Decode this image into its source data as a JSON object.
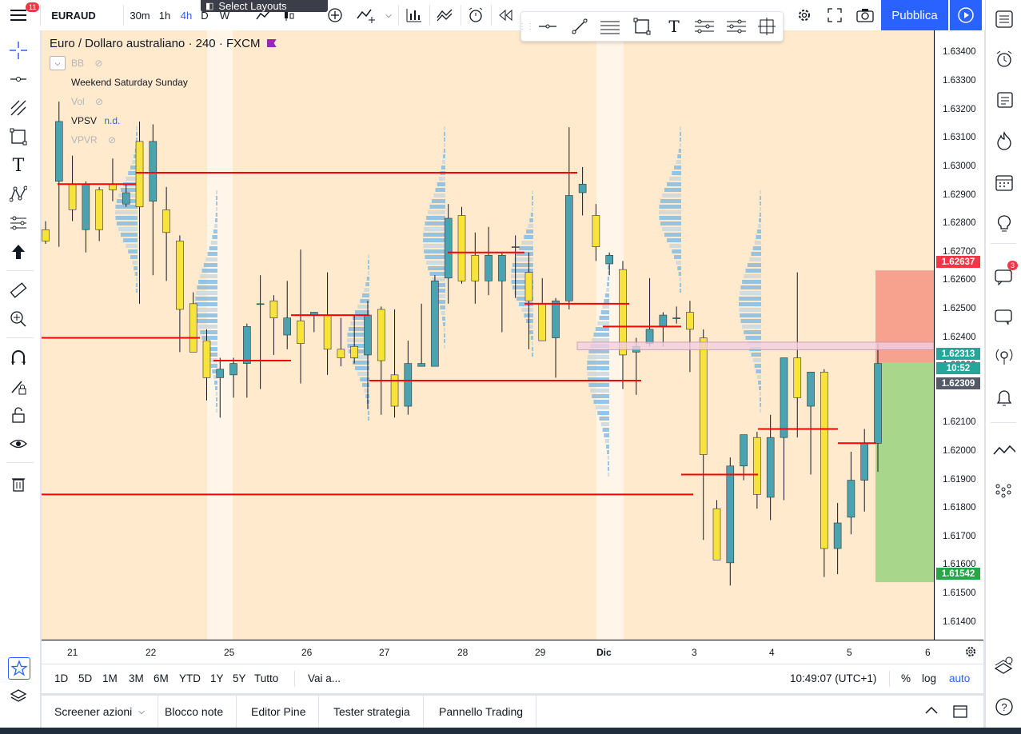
{
  "toolbar": {
    "menu_badge": "11",
    "symbol": "EURAUD",
    "intervals": [
      "30m",
      "1h",
      "4h",
      "D",
      "W"
    ],
    "active_interval": "4h",
    "publish_label": "Pubblica"
  },
  "select_layouts_label": "Select Layouts",
  "legend": {
    "title": "Euro / Dollaro australiano",
    "interval": "240",
    "exchange": "FXCM",
    "indicators": [
      {
        "name": "BB",
        "hidden": true
      },
      {
        "name": "Weekend Saturday Sunday",
        "hidden": false
      },
      {
        "name": "Vol",
        "hidden": true
      },
      {
        "name": "VPSV",
        "value": "n.d.",
        "hidden": false
      },
      {
        "name": "VPVR",
        "hidden": true
      }
    ]
  },
  "price_axis": {
    "labels": [
      "1.63400",
      "1.63300",
      "1.63200",
      "1.63100",
      "1.63000",
      "1.62900",
      "1.62800",
      "1.62700",
      "1.62600",
      "1.62500",
      "1.62400",
      "1.62300",
      "1.62100",
      "1.62000",
      "1.61900",
      "1.61800",
      "1.61700",
      "1.61600",
      "1.61500",
      "1.61400"
    ],
    "tags": [
      {
        "value": "1.62637",
        "color": "#f23645"
      },
      {
        "value": "1.62313",
        "color": "#26a69a"
      },
      {
        "value": "10:52",
        "color": "#26a69a"
      },
      {
        "value": "1.62309",
        "color": "#555b66"
      },
      {
        "value": "1.61542",
        "color": "#26a645"
      }
    ]
  },
  "time_axis": {
    "labels": [
      "21",
      "22",
      "25",
      "26",
      "27",
      "28",
      "29",
      "Dic",
      "3",
      "4",
      "5",
      "6"
    ]
  },
  "chart_data": {
    "type": "candlestick",
    "title": "Euro / Dollaro australiano",
    "ylim": [
      1.6134,
      1.6348
    ],
    "notes": "Candle values estimated from axis",
    "candles": [
      {
        "o": 1.6278,
        "h": 1.6281,
        "l": 1.6273,
        "c": 1.6274
      },
      {
        "o": 1.6295,
        "h": 1.6323,
        "l": 1.6272,
        "c": 1.6316
      },
      {
        "o": 1.6294,
        "h": 1.6304,
        "l": 1.6281,
        "c": 1.6285
      },
      {
        "o": 1.6278,
        "h": 1.6295,
        "l": 1.627,
        "c": 1.6294
      },
      {
        "o": 1.6292,
        "h": 1.6293,
        "l": 1.6274,
        "c": 1.6278
      },
      {
        "o": 1.6294,
        "h": 1.6303,
        "l": 1.6288,
        "c": 1.6292
      },
      {
        "o": 1.6287,
        "h": 1.6294,
        "l": 1.6286,
        "c": 1.6291
      },
      {
        "o": 1.6309,
        "h": 1.6316,
        "l": 1.6252,
        "c": 1.6286
      },
      {
        "o": 1.6288,
        "h": 1.6315,
        "l": 1.6262,
        "c": 1.6309
      },
      {
        "o": 1.6285,
        "h": 1.6293,
        "l": 1.626,
        "c": 1.6277
      },
      {
        "o": 1.6274,
        "h": 1.6276,
        "l": 1.6235,
        "c": 1.625
      },
      {
        "o": 1.6252,
        "h": 1.6256,
        "l": 1.6235,
        "c": 1.6235
      },
      {
        "o": 1.6239,
        "h": 1.6243,
        "l": 1.6218,
        "c": 1.6226
      },
      {
        "o": 1.6226,
        "h": 1.6233,
        "l": 1.6212,
        "c": 1.6229
      },
      {
        "o": 1.6227,
        "h": 1.6233,
        "l": 1.6219,
        "c": 1.6231
      },
      {
        "o": 1.6231,
        "h": 1.6245,
        "l": 1.6219,
        "c": 1.6244
      },
      {
        "o": 1.6252,
        "h": 1.6262,
        "l": 1.6222,
        "c": 1.6252
      },
      {
        "o": 1.6253,
        "h": 1.6255,
        "l": 1.6234,
        "c": 1.6247
      },
      {
        "o": 1.6241,
        "h": 1.626,
        "l": 1.6236,
        "c": 1.6247
      },
      {
        "o": 1.6246,
        "h": 1.6271,
        "l": 1.6224,
        "c": 1.6238
      },
      {
        "o": 1.6248,
        "h": 1.6249,
        "l": 1.6242,
        "c": 1.6249
      },
      {
        "o": 1.6248,
        "h": 1.6263,
        "l": 1.6227,
        "c": 1.6236
      },
      {
        "o": 1.6236,
        "h": 1.6247,
        "l": 1.623,
        "c": 1.6233
      },
      {
        "o": 1.6237,
        "h": 1.6248,
        "l": 1.6231,
        "c": 1.6233
      },
      {
        "o": 1.6234,
        "h": 1.6253,
        "l": 1.6215,
        "c": 1.6248
      },
      {
        "o": 1.625,
        "h": 1.6251,
        "l": 1.6213,
        "c": 1.6232
      },
      {
        "o": 1.6227,
        "h": 1.625,
        "l": 1.6212,
        "c": 1.6216
      },
      {
        "o": 1.6216,
        "h": 1.6239,
        "l": 1.6213,
        "c": 1.6231
      },
      {
        "o": 1.623,
        "h": 1.6252,
        "l": 1.623,
        "c": 1.6231
      },
      {
        "o": 1.623,
        "h": 1.6262,
        "l": 1.623,
        "c": 1.626
      },
      {
        "o": 1.6261,
        "h": 1.6287,
        "l": 1.6252,
        "c": 1.6282
      },
      {
        "o": 1.6283,
        "h": 1.6286,
        "l": 1.6259,
        "c": 1.626
      },
      {
        "o": 1.6269,
        "h": 1.6277,
        "l": 1.6252,
        "c": 1.626
      },
      {
        "o": 1.626,
        "h": 1.6279,
        "l": 1.6255,
        "c": 1.6269
      },
      {
        "o": 1.626,
        "h": 1.627,
        "l": 1.6242,
        "c": 1.6269
      },
      {
        "o": 1.6272,
        "h": 1.6276,
        "l": 1.6254,
        "c": 1.6272
      },
      {
        "o": 1.6263,
        "h": 1.627,
        "l": 1.6236,
        "c": 1.6253
      },
      {
        "o": 1.6252,
        "h": 1.6261,
        "l": 1.6239,
        "c": 1.6239
      },
      {
        "o": 1.624,
        "h": 1.6254,
        "l": 1.6226,
        "c": 1.6253
      },
      {
        "o": 1.6253,
        "h": 1.6314,
        "l": 1.625,
        "c": 1.629
      },
      {
        "o": 1.6291,
        "h": 1.63,
        "l": 1.6283,
        "c": 1.6294
      },
      {
        "o": 1.6283,
        "h": 1.6287,
        "l": 1.6267,
        "c": 1.6272
      },
      {
        "o": 1.6266,
        "h": 1.627,
        "l": 1.6262,
        "c": 1.6269
      },
      {
        "o": 1.6264,
        "h": 1.6267,
        "l": 1.6222,
        "c": 1.6234
      },
      {
        "o": 1.6235,
        "h": 1.624,
        "l": 1.622,
        "c": 1.6237
      },
      {
        "o": 1.6238,
        "h": 1.6261,
        "l": 1.6237,
        "c": 1.6243
      },
      {
        "o": 1.6244,
        "h": 1.6249,
        "l": 1.6237,
        "c": 1.6248
      },
      {
        "o": 1.6247,
        "h": 1.6251,
        "l": 1.6245,
        "c": 1.6247
      },
      {
        "o": 1.6249,
        "h": 1.6253,
        "l": 1.6228,
        "c": 1.6243
      },
      {
        "o": 1.624,
        "h": 1.6243,
        "l": 1.6169,
        "c": 1.6199
      },
      {
        "o": 1.618,
        "h": 1.6183,
        "l": 1.6162,
        "c": 1.6162
      },
      {
        "o": 1.6161,
        "h": 1.6198,
        "l": 1.6153,
        "c": 1.6195
      },
      {
        "o": 1.6195,
        "h": 1.6204,
        "l": 1.619,
        "c": 1.6206
      },
      {
        "o": 1.6205,
        "h": 1.6207,
        "l": 1.618,
        "c": 1.6185
      },
      {
        "o": 1.6184,
        "h": 1.6213,
        "l": 1.6176,
        "c": 1.6205
      },
      {
        "o": 1.6205,
        "h": 1.6227,
        "l": 1.6183,
        "c": 1.6233
      },
      {
        "o": 1.6233,
        "h": 1.6263,
        "l": 1.6205,
        "c": 1.6219
      },
      {
        "o": 1.6216,
        "h": 1.6223,
        "l": 1.6192,
        "c": 1.6228
      },
      {
        "o": 1.6228,
        "h": 1.6229,
        "l": 1.6156,
        "c": 1.6166
      },
      {
        "o": 1.6166,
        "h": 1.6182,
        "l": 1.6157,
        "c": 1.6175
      },
      {
        "o": 1.6177,
        "h": 1.62,
        "l": 1.6171,
        "c": 1.619
      },
      {
        "o": 1.619,
        "h": 1.6208,
        "l": 1.6179,
        "c": 1.6203
      },
      {
        "o": 1.6203,
        "h": 1.6238,
        "l": 1.6193,
        "c": 1.6231
      }
    ],
    "horizontal_lines": [
      1.6294,
      1.6298,
      1.624,
      1.6248,
      1.6232,
      1.6225,
      1.627,
      1.6252,
      1.6244,
      1.6185,
      1.6192,
      1.6208,
      1.6203
    ],
    "position_tool": {
      "entry": 1.62313,
      "target": 1.62637,
      "stop": 1.61542
    }
  },
  "range_bar": {
    "ranges": [
      "1D",
      "5D",
      "1M",
      "3M",
      "6M",
      "YTD",
      "1Y",
      "5Y",
      "Tutto"
    ],
    "goto": "Vai a...",
    "clock": "10:49:07 (UTC+1)",
    "percent": "%",
    "log": "log",
    "auto": "auto"
  },
  "bottom_tabs": [
    "Screener azioni",
    "Blocco note",
    "Editor Pine",
    "Tester strategia",
    "Pannello Trading"
  ],
  "sidebar": {
    "chat_badge": "3"
  },
  "colors": {
    "bull": "#4aa3b0",
    "bear": "#f7e33a",
    "accent": "#2962ff",
    "line": "#ff0000"
  }
}
